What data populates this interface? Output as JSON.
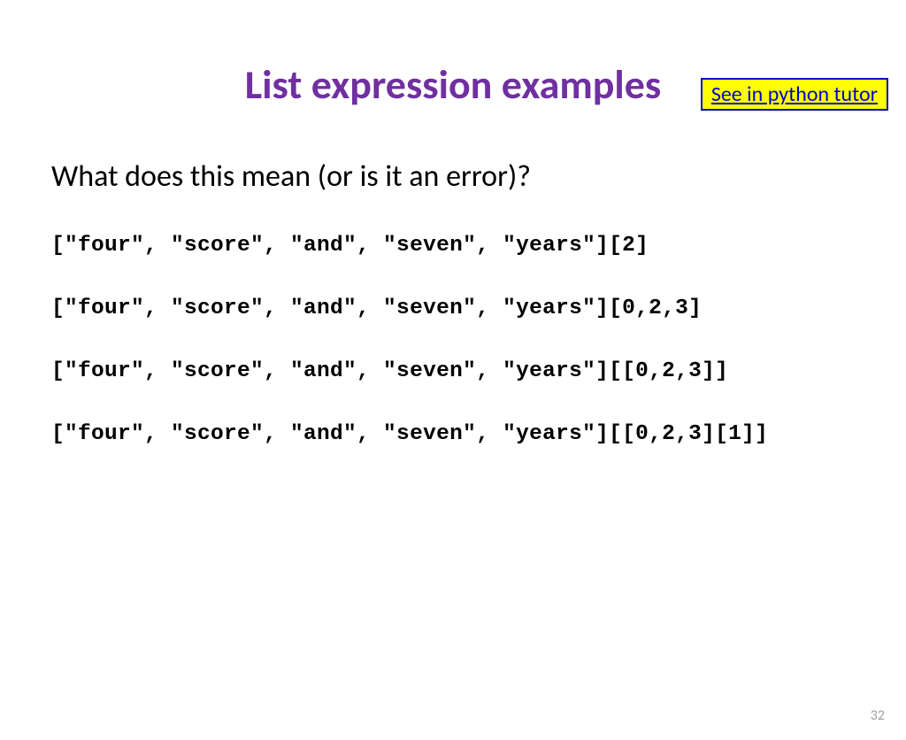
{
  "tutor_link": "See in python tutor",
  "title": "List expression examples",
  "question": "What does this mean (or is it an error)?",
  "code_lines": [
    "[\"four\", \"score\", \"and\", \"seven\", \"years\"][2]",
    "[\"four\", \"score\", \"and\", \"seven\", \"years\"][0,2,3]",
    "[\"four\", \"score\", \"and\", \"seven\", \"years\"][[0,2,3]]",
    "[\"four\", \"score\", \"and\", \"seven\", \"years\"][[0,2,3][1]]"
  ],
  "page_number": "32"
}
